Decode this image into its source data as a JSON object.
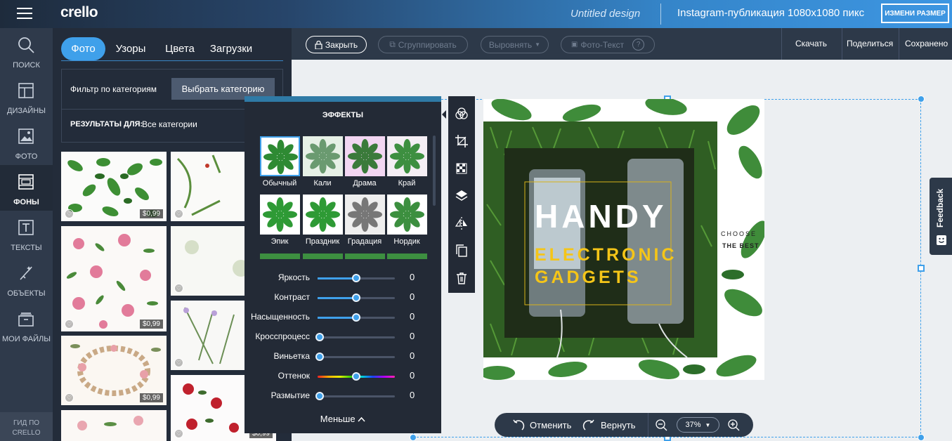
{
  "app": {
    "logo": "crello",
    "doc_title": "Untitled design",
    "doc_format": "Instagram-публикация 1080x1080 пикс",
    "resize_label": "ИЗМЕНИ РАЗМЕР"
  },
  "nav": {
    "items": [
      {
        "label": "ПОИСК",
        "icon": "search-icon"
      },
      {
        "label": "ДИЗАЙНЫ",
        "icon": "layout-icon"
      },
      {
        "label": "ФОТО",
        "icon": "image-icon"
      },
      {
        "label": "ФОНЫ",
        "icon": "backgrounds-icon"
      },
      {
        "label": "ТЕКСТЫ",
        "icon": "text-icon"
      },
      {
        "label": "ОБЪЕКТЫ",
        "icon": "objects-icon"
      },
      {
        "label": "МОИ ФАЙЛЫ",
        "icon": "folder-icon"
      }
    ],
    "active": "ФОНЫ",
    "guide": "ГИД ПО CRELLO"
  },
  "panel": {
    "tabs": [
      "Фото",
      "Узоры",
      "Цвета",
      "Загрузки"
    ],
    "active_tab": "Фото",
    "filter_label": "Фильтр по категориям",
    "category_button": "Выбрать категорию",
    "results_label": "РЕЗУЛЬТАТЫ ДЛЯ:",
    "results_value": "Все категории",
    "thumbs": [
      {
        "price": "$0,99"
      },
      {
        "price": ""
      },
      {
        "price": "$0,99"
      },
      {
        "price": ""
      },
      {
        "price": "$0,99"
      },
      {
        "price": ""
      },
      {
        "price": ""
      },
      {
        "price": "$0,99"
      }
    ]
  },
  "toolbar": {
    "lock": "Закрыть",
    "group": "Сгруппировать",
    "align": "Выровнять",
    "photo_text": "Фото-Текст",
    "download": "Скачать",
    "share": "Поделиться",
    "saved": "Сохранено"
  },
  "effects": {
    "title": "ЭФФЕКТЫ",
    "filters": [
      "Обычный",
      "Кали",
      "Драма",
      "Край",
      "Эпик",
      "Праздник",
      "Градация",
      "Нордик"
    ],
    "selected_filter": "Обычный",
    "sliders": [
      {
        "label": "Яркость",
        "value": "0",
        "level": 0.5
      },
      {
        "label": "Контраст",
        "value": "0",
        "level": 0.5
      },
      {
        "label": "Насыщенность",
        "value": "0",
        "level": 0.5
      },
      {
        "label": "Кросспроцесс",
        "value": "0",
        "level": 0
      },
      {
        "label": "Виньетка",
        "value": "0",
        "level": 0
      },
      {
        "label": "Оттенок",
        "value": "0",
        "level": 0.5
      },
      {
        "label": "Размытие",
        "value": "0",
        "level": 0
      }
    ],
    "less": "Меньше"
  },
  "design": {
    "headline": "HANDY",
    "subline1": "ELECTRONIC",
    "subline2": "GADGETS",
    "side1": "CHOOSE",
    "side2": "THE BEST",
    "accent": "#f5c518"
  },
  "bottom": {
    "undo": "Отменить",
    "redo": "Вернуть",
    "zoom": "37%"
  },
  "feedback": "Feedback",
  "colors": {
    "accent": "#3fa0ea",
    "panel": "#232c3a",
    "nav": "#2f3a4b"
  }
}
